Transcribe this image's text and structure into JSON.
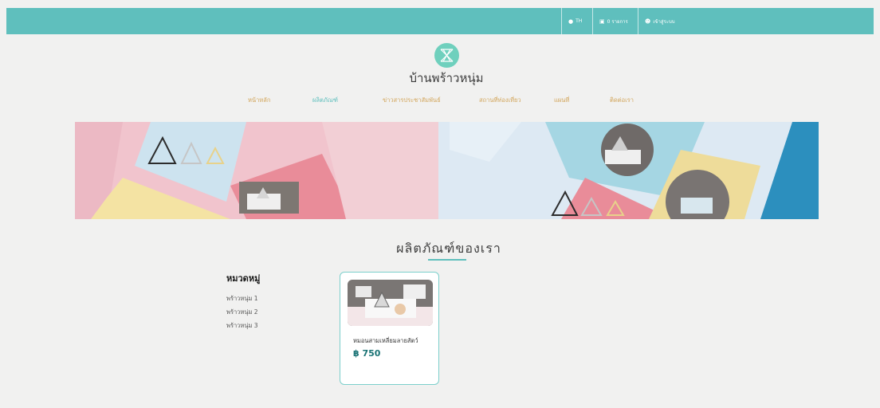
{
  "topbar": {
    "language": {
      "icon": "globe-icon",
      "label": "TH"
    },
    "cart": {
      "icon": "cart-icon",
      "label": "0 รายการ"
    },
    "account": {
      "icon": "user-icon",
      "label": "เข้าสู่ระบบ"
    }
  },
  "site": {
    "name": "บ้านพร้าวหนุ่ม",
    "logo_icon": "logo-icon"
  },
  "nav": {
    "items": [
      {
        "label": "หน้าหลัก"
      },
      {
        "label": "ผลิตภัณฑ์",
        "active": true
      },
      {
        "label": "ข่าวสารประชาสัมพันธ์"
      },
      {
        "label": "สถานที่ท่องเที่ยว"
      },
      {
        "label": "แผนที่"
      },
      {
        "label": "ติดต่อเรา"
      }
    ]
  },
  "products_section": {
    "title": "ผลิตภัณฑ์ของเรา"
  },
  "categories": {
    "heading": "หมวดหมู่",
    "items": [
      {
        "label": "พร้าวหนุ่ม 1"
      },
      {
        "label": "พร้าวหนุ่ม 2"
      },
      {
        "label": "พร้าวหนุ่ม 3"
      }
    ]
  },
  "products": [
    {
      "name": "หมอนสามเหลี่ยมลายสัตว์",
      "price": "฿ 750"
    }
  ],
  "colors": {
    "brand": "#5fbfbd",
    "nav_text": "#d2a55a",
    "price": "#1a7375"
  }
}
